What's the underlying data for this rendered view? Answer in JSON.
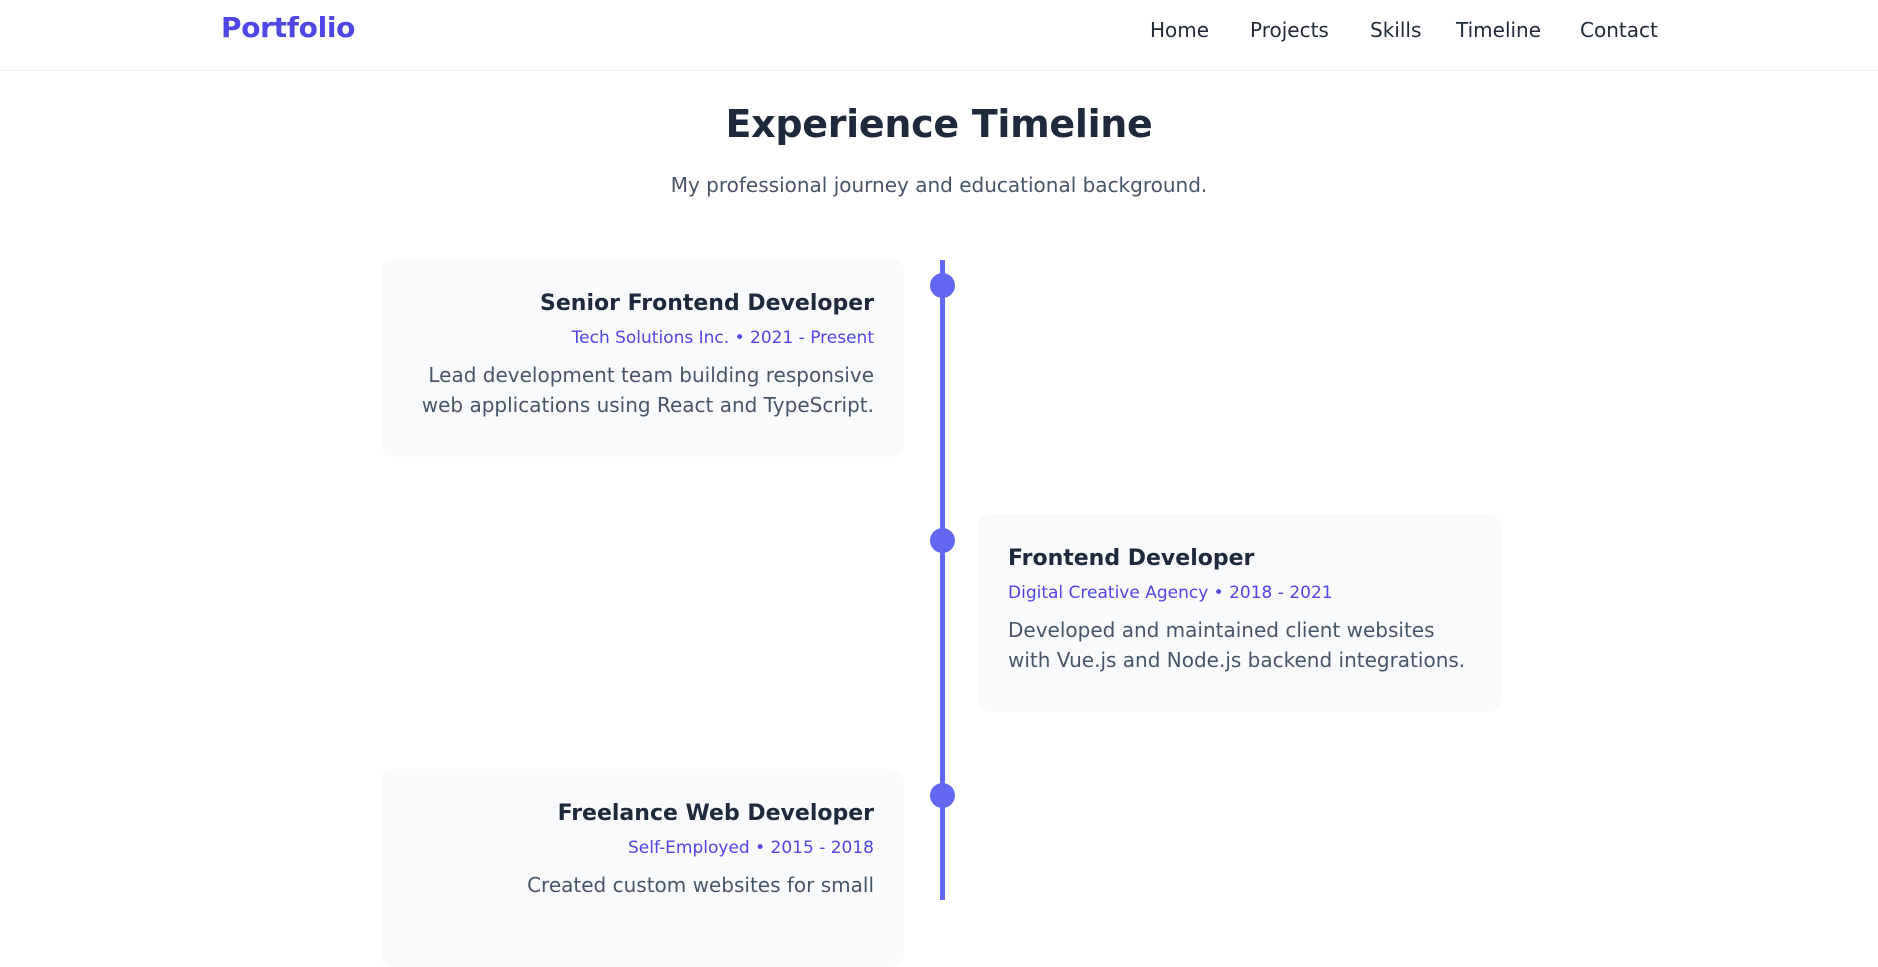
{
  "nav": {
    "brand": "Portfolio",
    "links": [
      "Home",
      "Projects",
      "Skills",
      "Timeline",
      "Contact"
    ]
  },
  "section": {
    "title": "Experience Timeline",
    "subtitle": "My professional journey and educational background."
  },
  "timeline": [
    {
      "title": "Senior Frontend Developer",
      "meta": "Tech Solutions Inc. • 2021 - Present",
      "description": "Lead development team building responsive web applications using React and TypeScript."
    },
    {
      "title": "Frontend Developer",
      "meta": "Digital Creative Agency • 2018 - 2021",
      "description": "Developed and maintained client websites with Vue.js and Node.js backend integrations."
    },
    {
      "title": "Freelance Web Developer",
      "meta": "Self-Employed • 2015 - 2018",
      "description": "Created custom websites for small"
    }
  ],
  "colors": {
    "accent": "#6366f1",
    "brand": "#4f46e5",
    "card_bg": "#f8fafc",
    "heading": "#1e293b",
    "body_text": "#475569"
  }
}
